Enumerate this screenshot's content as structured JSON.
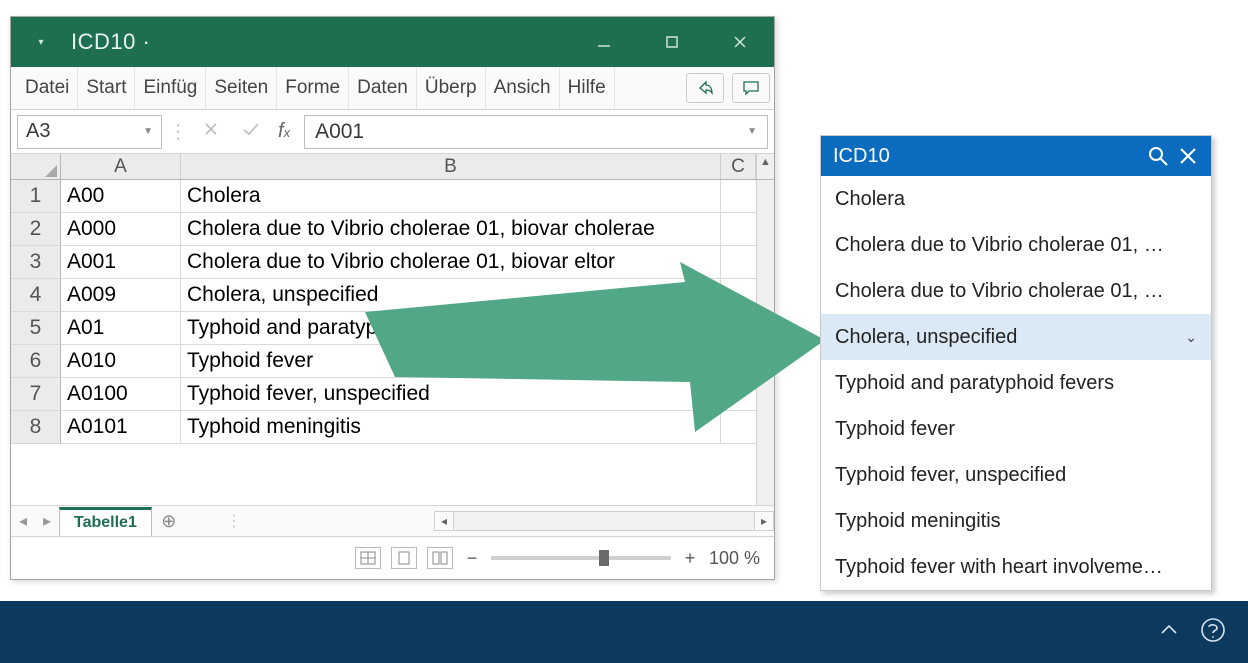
{
  "window": {
    "title": "ICD10 ·"
  },
  "ribbon": {
    "tabs": [
      "Datei",
      "Start",
      "Einfüg",
      "Seiten",
      "Forme",
      "Daten",
      "Überp",
      "Ansich",
      "Hilfe"
    ]
  },
  "namebox": {
    "value": "A3"
  },
  "formula": {
    "value": "A001"
  },
  "columns": {
    "A": "A",
    "B": "B",
    "C": "C"
  },
  "rows": [
    {
      "n": "1",
      "a": "A00",
      "b": "Cholera"
    },
    {
      "n": "2",
      "a": "A000",
      "b": "Cholera due to Vibrio cholerae 01, biovar cholerae"
    },
    {
      "n": "3",
      "a": "A001",
      "b": "Cholera due to Vibrio cholerae 01, biovar eltor"
    },
    {
      "n": "4",
      "a": "A009",
      "b": "Cholera, unspecified"
    },
    {
      "n": "5",
      "a": "A01",
      "b": "Typhoid and paratyphoid fevers"
    },
    {
      "n": "6",
      "a": "A010",
      "b": "Typhoid fever"
    },
    {
      "n": "7",
      "a": "A0100",
      "b": "Typhoid fever, unspecified"
    },
    {
      "n": "8",
      "a": "A0101",
      "b": "Typhoid meningitis"
    }
  ],
  "sheet": {
    "name": "Tabelle1"
  },
  "zoom": {
    "label": "100 %"
  },
  "icd_panel": {
    "title": "ICD10",
    "items": [
      "Cholera",
      "Cholera due to Vibrio cholerae 01, …",
      "Cholera due to Vibrio cholerae 01, …",
      "Cholera, unspecified",
      "Typhoid and paratyphoid fevers",
      "Typhoid fever",
      "Typhoid fever, unspecified",
      "Typhoid meningitis",
      "Typhoid fever with heart involveme…"
    ],
    "selected_index": 3
  },
  "colors": {
    "excel_green": "#1e6f50",
    "panel_blue": "#0b6cbf",
    "arrow_green": "#52a886",
    "bottom_bar": "#0b3a5e"
  }
}
